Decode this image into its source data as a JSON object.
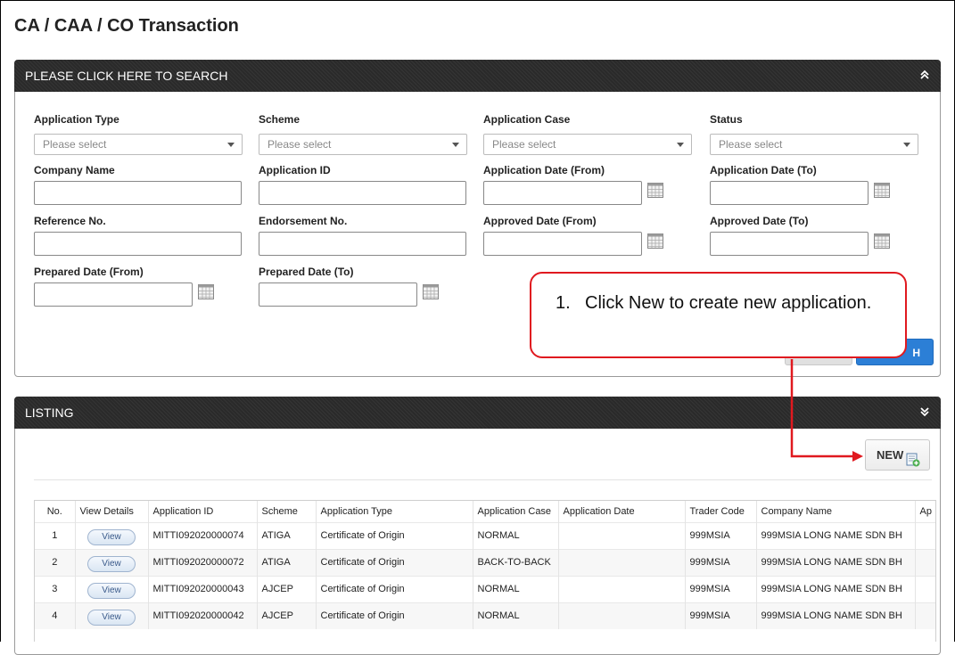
{
  "page": {
    "title": "CA / CAA / CO Transaction"
  },
  "search_panel": {
    "header": "PLEASE CLICK HERE TO SEARCH",
    "toggle_icon": "double-chevron-up-icon",
    "fields": {
      "application_type": {
        "label": "Application Type",
        "placeholder": "Please select"
      },
      "scheme": {
        "label": "Scheme",
        "placeholder": "Please select"
      },
      "application_case": {
        "label": "Application Case",
        "placeholder": "Please select"
      },
      "status": {
        "label": "Status",
        "placeholder": "Please select"
      },
      "company_name": {
        "label": "Company Name",
        "value": ""
      },
      "application_id": {
        "label": "Application ID",
        "value": ""
      },
      "application_date_from": {
        "label": "Application Date (From)",
        "value": ""
      },
      "application_date_to": {
        "label": "Application Date (To)",
        "value": ""
      },
      "reference_no": {
        "label": "Reference No.",
        "value": ""
      },
      "endorsement_no": {
        "label": "Endorsement No.",
        "value": ""
      },
      "approved_date_from": {
        "label": "Approved Date (From)",
        "value": ""
      },
      "approved_date_to": {
        "label": "Approved Date (To)",
        "value": ""
      },
      "prepared_date_from": {
        "label": "Prepared Date (From)",
        "value": ""
      },
      "prepared_date_to": {
        "label": "Prepared Date (To)",
        "value": ""
      }
    },
    "search_button_visible_text": "H"
  },
  "listing_panel": {
    "header": "LISTING",
    "toggle_icon": "double-chevron-down-icon",
    "new_button_label": "NEW",
    "new_button_icon": "add-document-icon",
    "columns": [
      "No.",
      "View Details",
      "Application ID",
      "Scheme",
      "Application Type",
      "Application Case",
      "Application Date",
      "Trader Code",
      "Company Name",
      "Ap"
    ],
    "rows": [
      {
        "no": "1",
        "view": "View",
        "application_id": "MITTI092020000074",
        "scheme": "ATIGA",
        "application_type": "Certificate of Origin",
        "application_case": "NORMAL",
        "application_date": "",
        "trader_code": "999MSIA",
        "company_name": "999MSIA LONG NAME SDN BH"
      },
      {
        "no": "2",
        "view": "View",
        "application_id": "MITTI092020000072",
        "scheme": "ATIGA",
        "application_type": "Certificate of Origin",
        "application_case": "BACK-TO-BACK",
        "application_date": "",
        "trader_code": "999MSIA",
        "company_name": "999MSIA LONG NAME SDN BH"
      },
      {
        "no": "3",
        "view": "View",
        "application_id": "MITTI092020000043",
        "scheme": "AJCEP",
        "application_type": "Certificate of Origin",
        "application_case": "NORMAL",
        "application_date": "",
        "trader_code": "999MSIA",
        "company_name": "999MSIA LONG NAME SDN BH"
      },
      {
        "no": "4",
        "view": "View",
        "application_id": "MITTI092020000042",
        "scheme": "AJCEP",
        "application_type": "Certificate of Origin",
        "application_case": "NORMAL",
        "application_date": "",
        "trader_code": "999MSIA",
        "company_name": "999MSIA LONG NAME SDN BH"
      }
    ]
  },
  "callout": {
    "number": "1.",
    "text": "Click New to create new application.",
    "color": "#e0191f"
  },
  "colors": {
    "panel_header": "#2a2a2a",
    "search_button": "#2c7fd6",
    "callout_border": "#e0191f"
  }
}
